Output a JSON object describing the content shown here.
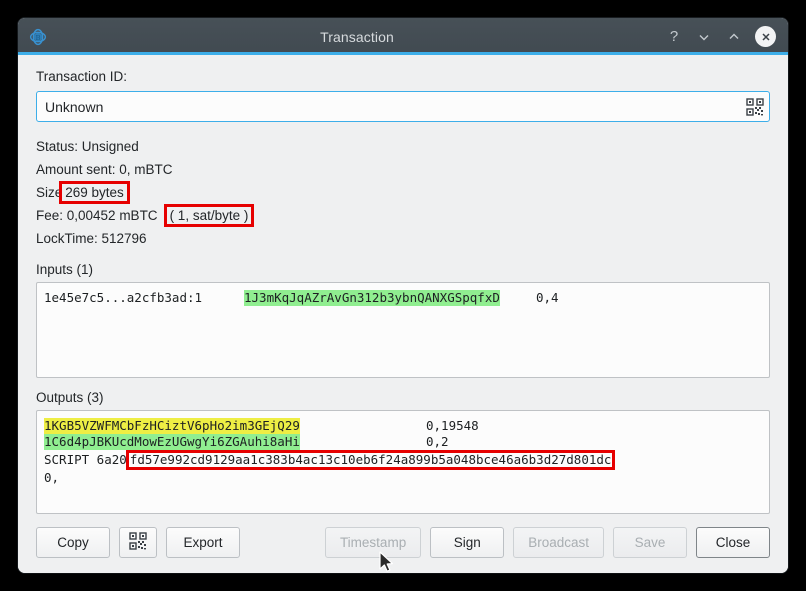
{
  "window": {
    "title": "Transaction",
    "logo_icon": "electrum-logo-icon",
    "controls": {
      "help_label": "?",
      "minimize_icon": "chevron-down-icon",
      "maximize_icon": "chevron-up-icon",
      "close_icon": "close-icon"
    }
  },
  "form": {
    "txid_label": "Transaction ID:",
    "txid_value": "Unknown",
    "txid_placeholder": "Unknown",
    "qr_icon": "qr-code-icon"
  },
  "info": {
    "status_label": "Status:",
    "status_value": "Unsigned",
    "status_line": "Status: Unsigned",
    "amount_line": "Amount sent: 0, mBTC",
    "size_prefix": "Size",
    "size_value": "269 bytes",
    "fee_prefix": "Fee: 0,00452 mBTC",
    "fee_rate": "( 1, sat/byte )",
    "locktime_line": "LockTime: 512796"
  },
  "inputs": {
    "title": "Inputs (1)",
    "rows": [
      {
        "outpoint": "1e45e7c5...a2cfb3ad:1",
        "address": "1J3mKqJqAZrAvGn312b3ybnQANXGSpqfxD",
        "amount": "0,4"
      }
    ]
  },
  "outputs": {
    "title": "Outputs (3)",
    "rows": [
      {
        "address": "1KGB5VZWFMCbFzHCiztV6pHo2im3GEjQ29",
        "amount": "0,19548"
      },
      {
        "address": "1C6d4pJBKUcdMowEzUGwgYi6ZGAuhi8aHi",
        "amount": "0,2"
      }
    ],
    "script_prefix": "SCRIPT 6a20",
    "script_hex": "fd57e992cd9129aa1c383b4ac13c10eb6f24a899b5a048bce46a6b3d27d801dc",
    "script_amount": "0,"
  },
  "buttons": {
    "copy": "Copy",
    "qr": "qr-code-icon",
    "export": "Export",
    "timestamp": "Timestamp",
    "sign": "Sign",
    "broadcast": "Broadcast",
    "save": "Save",
    "close": "Close"
  },
  "colors": {
    "accent": "#3daee9",
    "titlebar": "#414a51",
    "window_bg": "#eff0f1",
    "highlight_green": "#90ee90",
    "highlight_yellow": "#eeee44",
    "annotation_red": "#e60000"
  }
}
